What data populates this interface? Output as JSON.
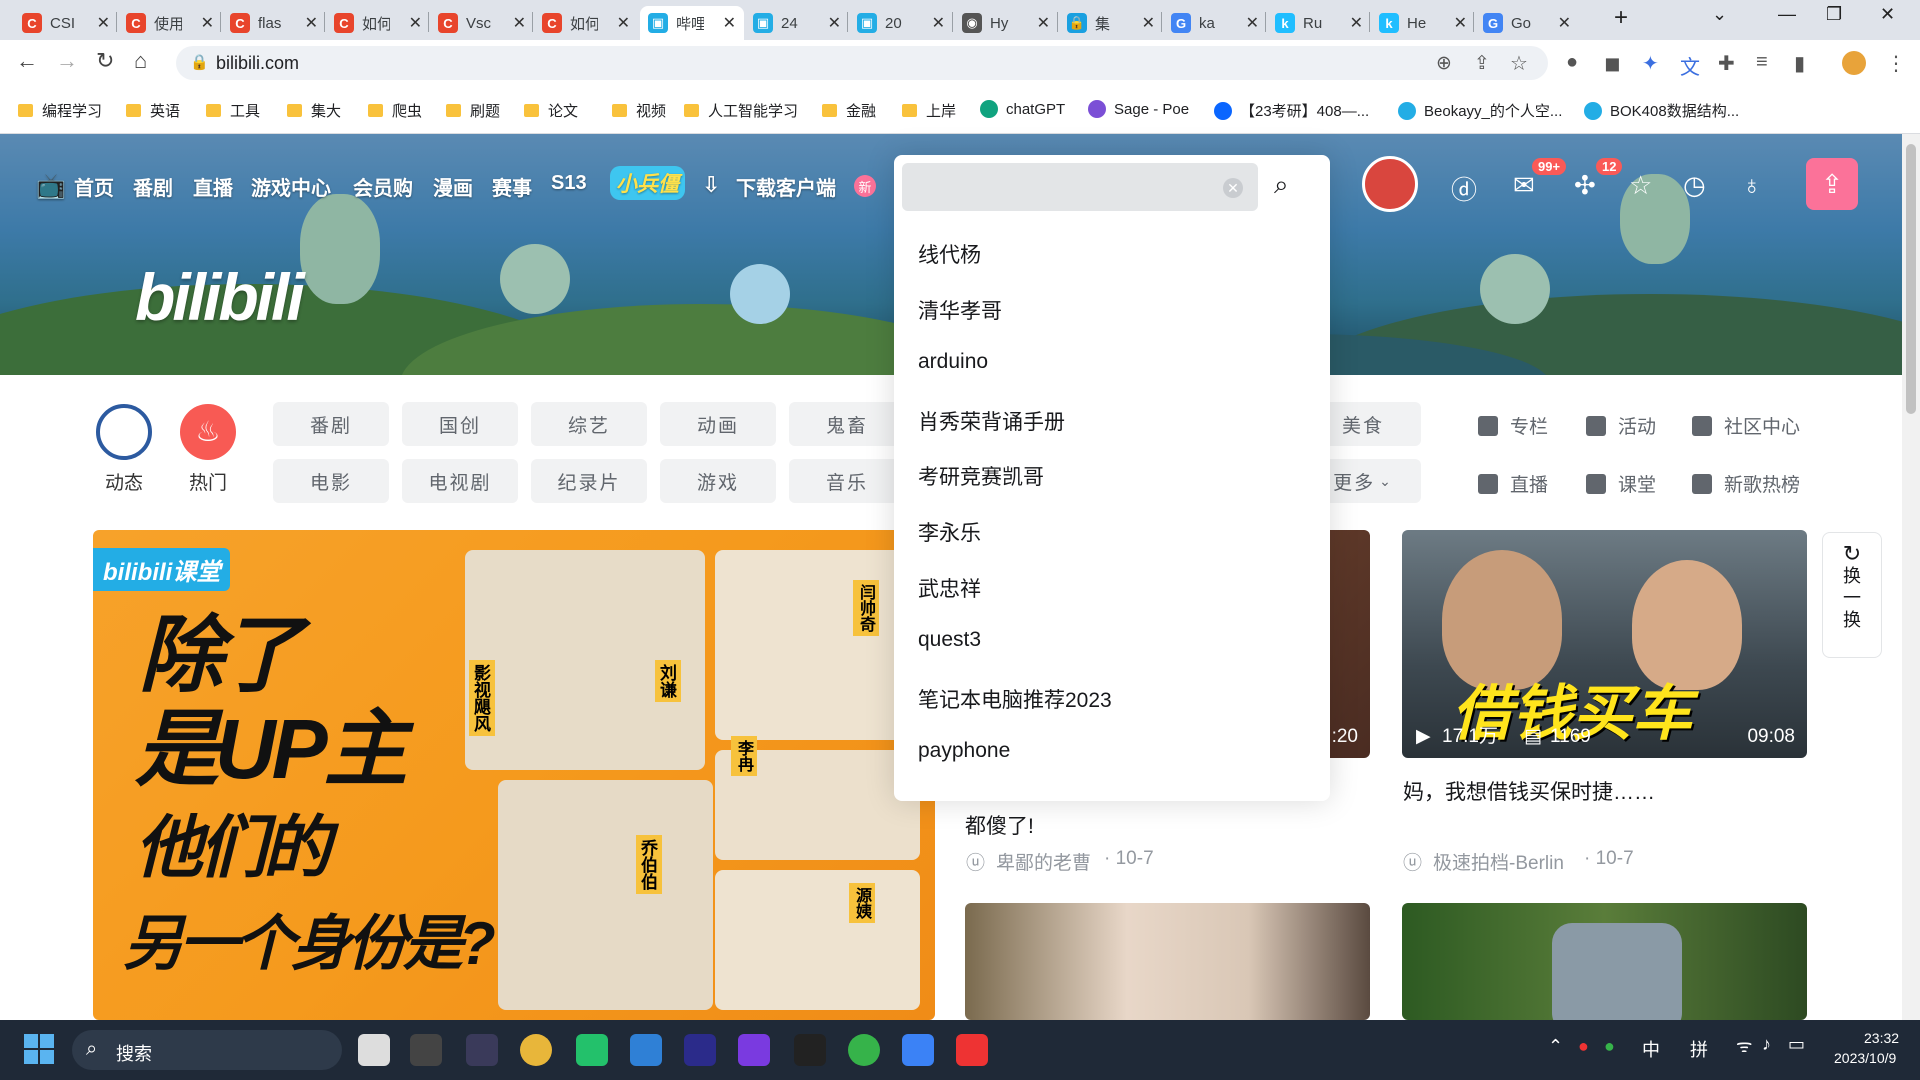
{
  "tabs": [
    {
      "title": "CSI",
      "favicon": "C",
      "color": "#e8452c"
    },
    {
      "title": "使用",
      "favicon": "C",
      "color": "#e8452c"
    },
    {
      "title": "flas",
      "favicon": "C",
      "color": "#e8452c"
    },
    {
      "title": "如何",
      "favicon": "C",
      "color": "#e8452c"
    },
    {
      "title": "Vsc",
      "favicon": "C",
      "color": "#e8452c"
    },
    {
      "title": "如何",
      "favicon": "C",
      "color": "#e8452c"
    },
    {
      "title": "哔哩",
      "favicon": "▣",
      "color": "#23ade5"
    },
    {
      "title": "24",
      "favicon": "▣",
      "color": "#23ade5"
    },
    {
      "title": "20",
      "favicon": "▣",
      "color": "#23ade5"
    },
    {
      "title": "Hy",
      "favicon": "◉",
      "color": "#555"
    },
    {
      "title": "集",
      "favicon": "🔒",
      "color": "#1aa0e0"
    },
    {
      "title": "ka",
      "favicon": "G",
      "color": "#4285f4"
    },
    {
      "title": "Ru",
      "favicon": "k",
      "color": "#20beff"
    },
    {
      "title": "He",
      "favicon": "k",
      "color": "#20beff"
    },
    {
      "title": "Go",
      "favicon": "G",
      "color": "#4285f4"
    }
  ],
  "active_tab_index": 6,
  "url": "bilibili.com",
  "bookmarks": [
    {
      "label": "编程学习",
      "type": "folder"
    },
    {
      "label": "英语",
      "type": "folder"
    },
    {
      "label": "工具",
      "type": "folder"
    },
    {
      "label": "集大",
      "type": "folder"
    },
    {
      "label": "爬虫",
      "type": "folder"
    },
    {
      "label": "刷题",
      "type": "folder"
    },
    {
      "label": "论文",
      "type": "folder"
    },
    {
      "label": "视频",
      "type": "folder"
    },
    {
      "label": "人工智能学习",
      "type": "folder"
    },
    {
      "label": "金融",
      "type": "folder"
    },
    {
      "label": "上岸",
      "type": "folder"
    },
    {
      "label": "chatGPT",
      "type": "site",
      "color": "#10a37f"
    },
    {
      "label": "Sage - Poe",
      "type": "site",
      "color": "#7b4fd6"
    },
    {
      "label": "【23考研】408—...",
      "type": "site",
      "color": "#0a66ff"
    },
    {
      "label": "Beokayy_的个人空...",
      "type": "site",
      "color": "#23ade5"
    },
    {
      "label": "BOK408数据结构...",
      "type": "site",
      "color": "#23ade5"
    }
  ],
  "header": {
    "nav": [
      "首页",
      "番剧",
      "直播",
      "游戏中心",
      "会员购",
      "漫画",
      "赛事",
      "S13",
      "小兵僵",
      "下载客户端"
    ],
    "new_badge": "新",
    "msg_badge": "99+",
    "dynamic_badge": "12",
    "logo": "bilibili"
  },
  "search": {
    "value": "",
    "suggestions": [
      "线代杨",
      "清华孝哥",
      "arduino",
      "肖秀荣背诵手册",
      "考研竞赛凯哥",
      "李永乐",
      "武忠祥",
      "quest3",
      "笔记本电脑推荐2023",
      "payphone"
    ]
  },
  "channels": [
    {
      "label": "动态",
      "color": "#ffffff"
    },
    {
      "label": "热门",
      "color": "#f85a54"
    }
  ],
  "categories_row1": [
    "番剧",
    "国创",
    "综艺",
    "动画",
    "鬼畜"
  ],
  "categories_row2": [
    "电影",
    "电视剧",
    "纪录片",
    "游戏",
    "音乐"
  ],
  "categories_extra": [
    "美食",
    "更多"
  ],
  "right_links": [
    "专栏",
    "活动",
    "社区中心",
    "直播",
    "课堂",
    "新歌热榜"
  ],
  "banner_card": {
    "brand": "bilibili课堂",
    "line1": "除了",
    "line2": "是UP主",
    "line3": "他们的",
    "line4": "另一个身份是?",
    "names": [
      "影视飓风",
      "刘谦",
      "闫帅奇",
      "李冉",
      "乔伯伯",
      "源姨"
    ]
  },
  "videos": [
    {
      "title_tail": "都傻了!",
      "author": "卑鄙的老曹",
      "date": "· 10-7",
      "duration": ":20"
    },
    {
      "title": "妈，我想借钱买保时捷……",
      "author": "极速拍档-Berlin",
      "date": "· 10-7",
      "duration": "09:08",
      "views": "17.1万",
      "danmaku": "1169",
      "overlay": "借钱买车"
    }
  ],
  "refresh_label": [
    "换",
    "一",
    "换"
  ],
  "taskbar": {
    "search": "搜索",
    "time": "23:32",
    "date": "2023/10/9",
    "ime1": "中",
    "ime2": "拼"
  }
}
